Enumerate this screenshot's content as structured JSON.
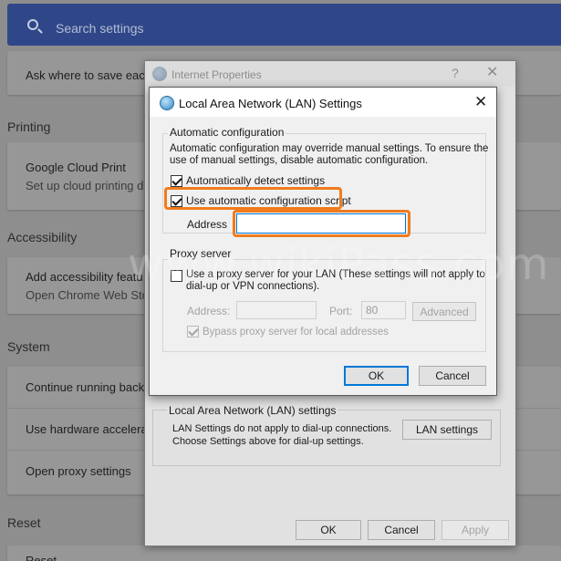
{
  "chrome_settings": {
    "search_placeholder": "Search settings",
    "downloads_row": "Ask where to save eac",
    "printing": {
      "section_title": "Printing",
      "row_title": "Google Cloud Print",
      "row_sub": "Set up cloud printing d"
    },
    "accessibility": {
      "section_title": "Accessibility",
      "row_title": "Add accessibility featu",
      "row_sub": "Open Chrome Web Sto"
    },
    "system": {
      "section_title": "System",
      "rows": [
        "Continue running back",
        "Use hardware accelera",
        "Open proxy settings"
      ]
    },
    "reset": {
      "section_title": "Reset",
      "row_partial": "Reset"
    }
  },
  "watermark": "www.wikiPass.com",
  "internet_properties": {
    "title": "Internet Properties",
    "help": "?",
    "close": "✕",
    "lan_group_label": "Local Area Network (LAN) settings",
    "lan_text_line1": "LAN Settings do not apply to dial-up connections.",
    "lan_text_line2": "Choose Settings above for dial-up settings.",
    "lan_settings_button": "LAN settings",
    "ok": "OK",
    "cancel": "Cancel",
    "apply": "Apply"
  },
  "lan_dialog": {
    "title": "Local Area Network (LAN) Settings",
    "close": "✕",
    "auto_config": {
      "label": "Automatic configuration",
      "info_line1": "Automatic configuration may override manual settings.  To ensure the",
      "info_line2": "use of manual settings, disable automatic configuration.",
      "auto_detect_label": "Automatically detect settings",
      "auto_detect_checked": true,
      "use_script_label": "Use automatic configuration script",
      "use_script_checked": true,
      "address_label": "Address",
      "address_value": ""
    },
    "proxy": {
      "label": "Proxy server",
      "use_proxy_line1": "Use a proxy server for your LAN (These settings will not apply to",
      "use_proxy_line2": "dial-up or VPN connections).",
      "use_proxy_checked": false,
      "address_label": "Address:",
      "address_value": "",
      "port_label": "Port:",
      "port_value": "80",
      "advanced": "Advanced",
      "bypass_label": "Bypass proxy server for local addresses",
      "bypass_checked": true
    },
    "ok": "OK",
    "cancel": "Cancel"
  },
  "colors": {
    "highlight": "#f07c1e",
    "search_bar": "#2f4789",
    "default_button_border": "#0078d7"
  }
}
